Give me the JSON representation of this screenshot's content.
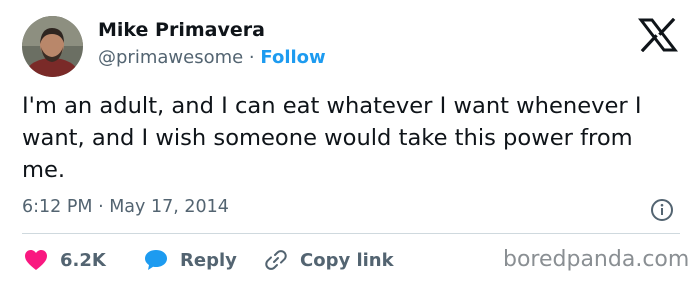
{
  "author": {
    "name": "Mike Primavera",
    "handle": "@primawesome",
    "separator": "·",
    "follow_label": "Follow"
  },
  "platform_icon": "x-logo-icon",
  "tweet": {
    "text": "I'm an adult, and I can eat whatever I want whenever I want, and I wish someone would take this power from me.",
    "timestamp": "6:12 PM · May 17, 2014"
  },
  "actions": {
    "likes_count": "6.2K",
    "reply_label": "Reply",
    "copy_link_label": "Copy link"
  },
  "watermark": "boredpanda.com",
  "colors": {
    "accent": "#1d9bf0",
    "heart": "#f91880",
    "text": "#0f1419",
    "muted": "#536471"
  }
}
